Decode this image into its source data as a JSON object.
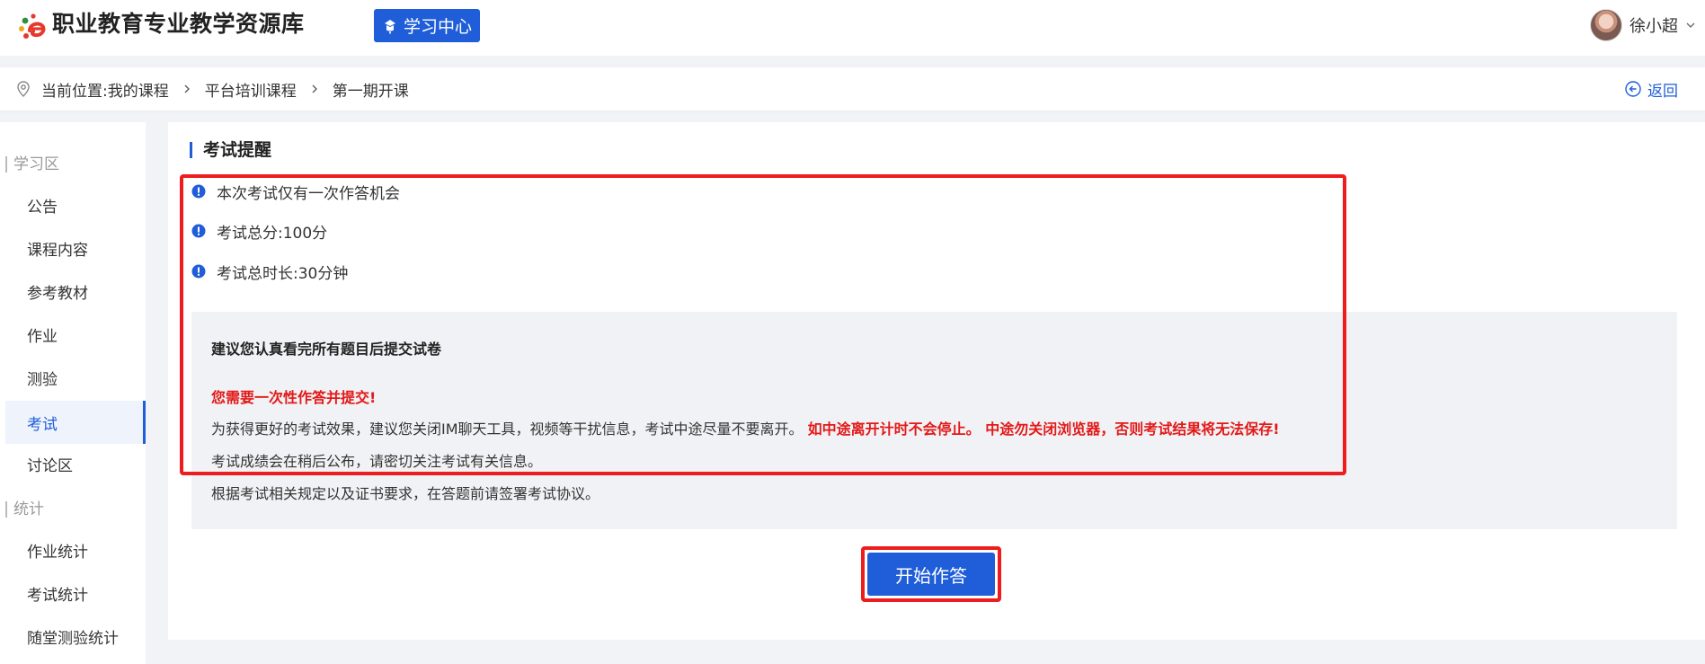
{
  "header": {
    "site_title": "职业教育专业教学资源库",
    "learn_center_label": "学习中心",
    "user_name": "徐小超"
  },
  "breadcrumb": {
    "prefix": "当前位置:",
    "items": [
      "我的课程",
      "平台培训课程",
      "第一期开课"
    ],
    "back_label": "返回"
  },
  "sidebar": {
    "groups": [
      {
        "title": "学习区",
        "items": [
          "公告",
          "课程内容",
          "参考教材",
          "作业",
          "测验",
          "考试",
          "讨论区"
        ]
      },
      {
        "title": "统计",
        "items": [
          "作业统计",
          "考试统计",
          "随堂测验统计"
        ]
      }
    ],
    "active_item": "考试"
  },
  "exam": {
    "section_title": "考试提醒",
    "tips": [
      "本次考试仅有一次作答机会",
      "考试总分:100分",
      "考试总时长:30分钟"
    ],
    "notice": {
      "title": "建议您认真看完所有题目后提交试卷",
      "red_heading": "您需要一次性作答并提交!",
      "line1_normal": "为获得更好的考试效果，建议您关闭IM聊天工具，视频等干扰信息，考试中途尽量不要离开。",
      "line1_warn": "如中途离开计时不会停止。 中途勿关闭浏览器，否则考试结果将无法保存!",
      "line2": "考试成绩会在稍后公布，请密切关注考试有关信息。",
      "line3": "根据考试相关规定以及证书要求，在答题前请签署考试协议。"
    },
    "start_label": "开始作答"
  },
  "colors": {
    "brand_blue": "#1f5ed8",
    "warning_red": "#e31818",
    "highlight_border": "#ee1c1c"
  }
}
